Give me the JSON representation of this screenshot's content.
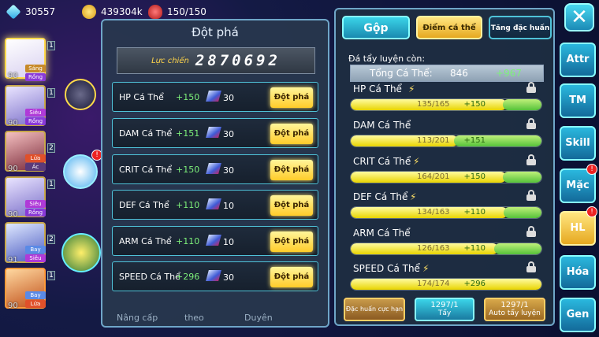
{
  "resources": {
    "diamonds": "30557",
    "gold": "439304k",
    "stamina": "150/150"
  },
  "roster": [
    {
      "level": "90",
      "tags": [
        "Sáng",
        "Rồng"
      ],
      "badge": "1",
      "selected": true
    },
    {
      "level": "90",
      "tags": [
        "Siêu",
        "Rồng"
      ],
      "badge": "1",
      "selected": false
    },
    {
      "level": "90",
      "tags": [
        "Lửa",
        "Ác"
      ],
      "badge": "2",
      "selected": false
    },
    {
      "level": "90",
      "tags": [
        "Siêu",
        "Rồng"
      ],
      "badge": "1",
      "selected": false
    },
    {
      "level": "91",
      "tags": [
        "Bay",
        "Siêu"
      ],
      "badge": "2",
      "selected": false
    },
    {
      "level": "90",
      "tags": [
        "Bay",
        "Lửa"
      ],
      "badge": "1",
      "selected": false
    }
  ],
  "breakthrough": {
    "title": "Đột phá",
    "power_label": "Lực chiến",
    "power_value": "2870692",
    "rows": [
      {
        "name": "HP Cá Thể",
        "bonus": "+150",
        "cost": "30",
        "button": "Đột phá"
      },
      {
        "name": "DAM Cá Thể",
        "bonus": "+151",
        "cost": "30",
        "button": "Đột phá"
      },
      {
        "name": "CRIT Cá Thể",
        "bonus": "+150",
        "cost": "30",
        "button": "Đột phá"
      },
      {
        "name": "DEF Cá Thể",
        "bonus": "+110",
        "cost": "10",
        "button": "Đột phá"
      },
      {
        "name": "ARM Cá Thể",
        "bonus": "+110",
        "cost": "10",
        "button": "Đột phá"
      },
      {
        "name": "SPEED Cá Thể",
        "bonus": "+296",
        "cost": "30",
        "button": "Đột phá"
      }
    ],
    "bottom_labels": [
      "Nâng cấp",
      "theo",
      "Duyên"
    ]
  },
  "individual": {
    "tabs": {
      "gop": "Gộp",
      "diem": "Điểm cá thể",
      "tang": "Tăng đặc huấn"
    },
    "stone_label": "Đá tẩy luyện còn:",
    "total_label": "Tổng Cá Thể:",
    "total_value": "846",
    "total_plus": "+967",
    "stats": [
      {
        "name": "HP Cá Thể",
        "value": "135/165",
        "plus": "+150",
        "fraction": 0.818,
        "bolt": true
      },
      {
        "name": "DAM Cá Thể",
        "value": "113/201",
        "plus": "+151",
        "fraction": 0.562,
        "bolt": false
      },
      {
        "name": "CRIT Cá Thể",
        "value": "164/201",
        "plus": "+150",
        "fraction": 0.816,
        "bolt": true
      },
      {
        "name": "DEF Cá Thể",
        "value": "134/163",
        "plus": "+110",
        "fraction": 0.822,
        "bolt": true
      },
      {
        "name": "ARM Cá Thể",
        "value": "126/163",
        "plus": "+110",
        "fraction": 0.773,
        "bolt": false
      },
      {
        "name": "SPEED Cá Thể",
        "value": "174/174",
        "plus": "+296",
        "fraction": 1.0,
        "bolt": true
      }
    ],
    "buttons": {
      "special": "Đặc huấn cực hạn",
      "wash_count": "1297/1",
      "wash": "Tẩy",
      "auto_count": "1297/1",
      "auto": "Auto tẩy luyện"
    }
  },
  "side_menu": [
    {
      "label": "Attr",
      "notif": ""
    },
    {
      "label": "TM",
      "notif": ""
    },
    {
      "label": "Skill",
      "notif": ""
    },
    {
      "label": "Mặc",
      "notif": "!"
    },
    {
      "label": "HL",
      "notif": "!"
    },
    {
      "label": "Hóa",
      "notif": ""
    },
    {
      "label": "Gen",
      "notif": ""
    }
  ],
  "close_label": "✕",
  "colors": {
    "accent": "#2ab8de",
    "gold": "#ffcc2a",
    "plus": "#7df07a"
  }
}
